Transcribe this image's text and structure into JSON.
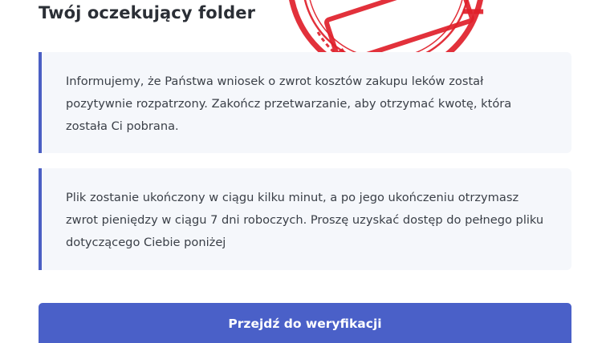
{
  "header": {
    "title": "Twój oczekujący folder"
  },
  "notices": [
    {
      "text": "Informujemy, że Państwa wniosek o zwrot kosztów zakupu leków został pozytywnie rozpatrzony. Zakończ przetwarzanie, aby otrzymać kwotę, która została Ci pobrana."
    },
    {
      "text": "Plik zostanie ukończony w ciągu kilku minut, a po jego ukończeniu otrzymasz zwrot pieniędzy w ciągu 7 dni roboczych. Proszę uzyskać dostęp do pełnego pliku dotyczącego Ciebie poniżej"
    }
  ],
  "actions": {
    "verify_label": "Przejdź do weryfikacji"
  },
  "colors": {
    "accent": "#4a60c8",
    "notice_border": "#4b5fc4",
    "notice_bg": "#f5f7fb",
    "stamp": "#e0202a"
  },
  "icons": {
    "stamp": "approved-stamp-icon"
  }
}
